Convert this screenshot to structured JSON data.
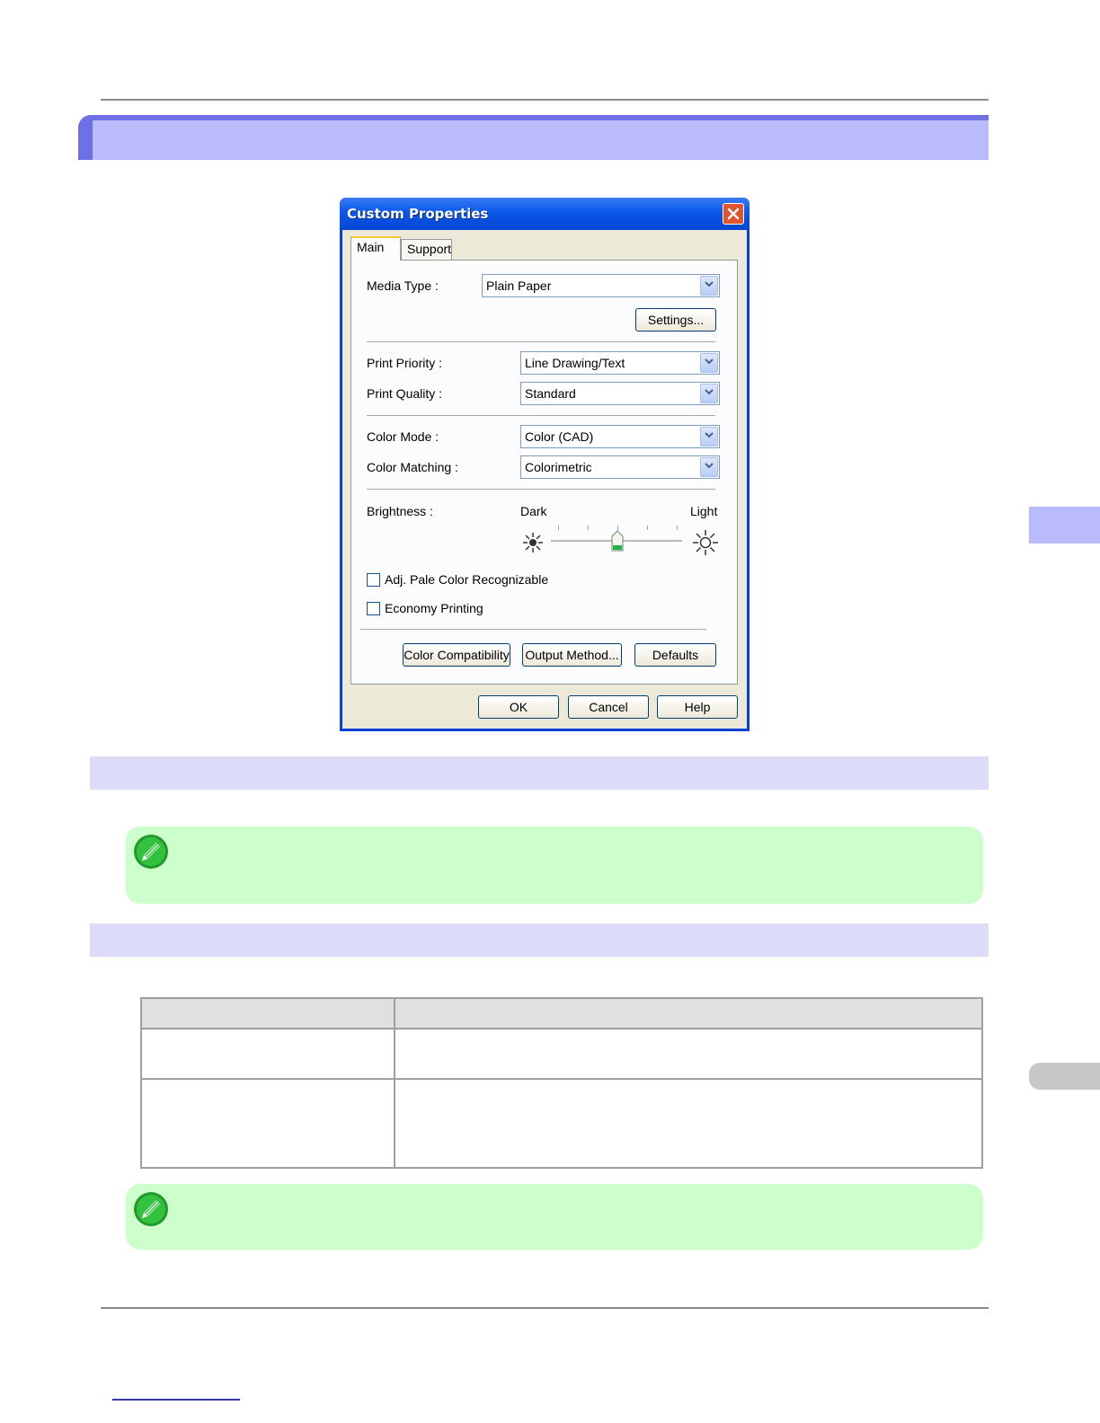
{
  "dialog": {
    "title": "Custom Properties",
    "tabs": [
      "Main",
      "Support"
    ],
    "media_type": {
      "label": "Media Type :",
      "value": "Plain Paper"
    },
    "settings_button": "Settings...",
    "print_priority": {
      "label": "Print Priority :",
      "value": "Line Drawing/Text"
    },
    "print_quality": {
      "label": "Print Quality :",
      "value": "Standard"
    },
    "color_mode": {
      "label": "Color Mode :",
      "value": "Color (CAD)"
    },
    "color_matching": {
      "label": "Color Matching :",
      "value": "Colorimetric"
    },
    "brightness": {
      "label": "Brightness :",
      "dark": "Dark",
      "light": "Light",
      "level_fraction": 0.5
    },
    "checkboxes": [
      {
        "label": "Adj. Pale Color Recognizable",
        "checked": false
      },
      {
        "label": "Economy Printing",
        "checked": false
      }
    ],
    "buttons": {
      "color_compatibility": "Color Compatibility",
      "output_method": "Output Method...",
      "defaults": "Defaults",
      "ok": "OK",
      "cancel": "Cancel",
      "help": "Help"
    }
  },
  "colors": {
    "title_band": "#b9bbfb",
    "title_band_accent": "#6f6fe6",
    "section_band": "#dcdcf8",
    "note_background": "#ccffcc",
    "table_header": "#e0e0e0"
  },
  "icons": [
    "note-pencil-icon",
    "close-icon",
    "chevron-down-icon",
    "sun-dark-icon",
    "sun-light-icon"
  ]
}
